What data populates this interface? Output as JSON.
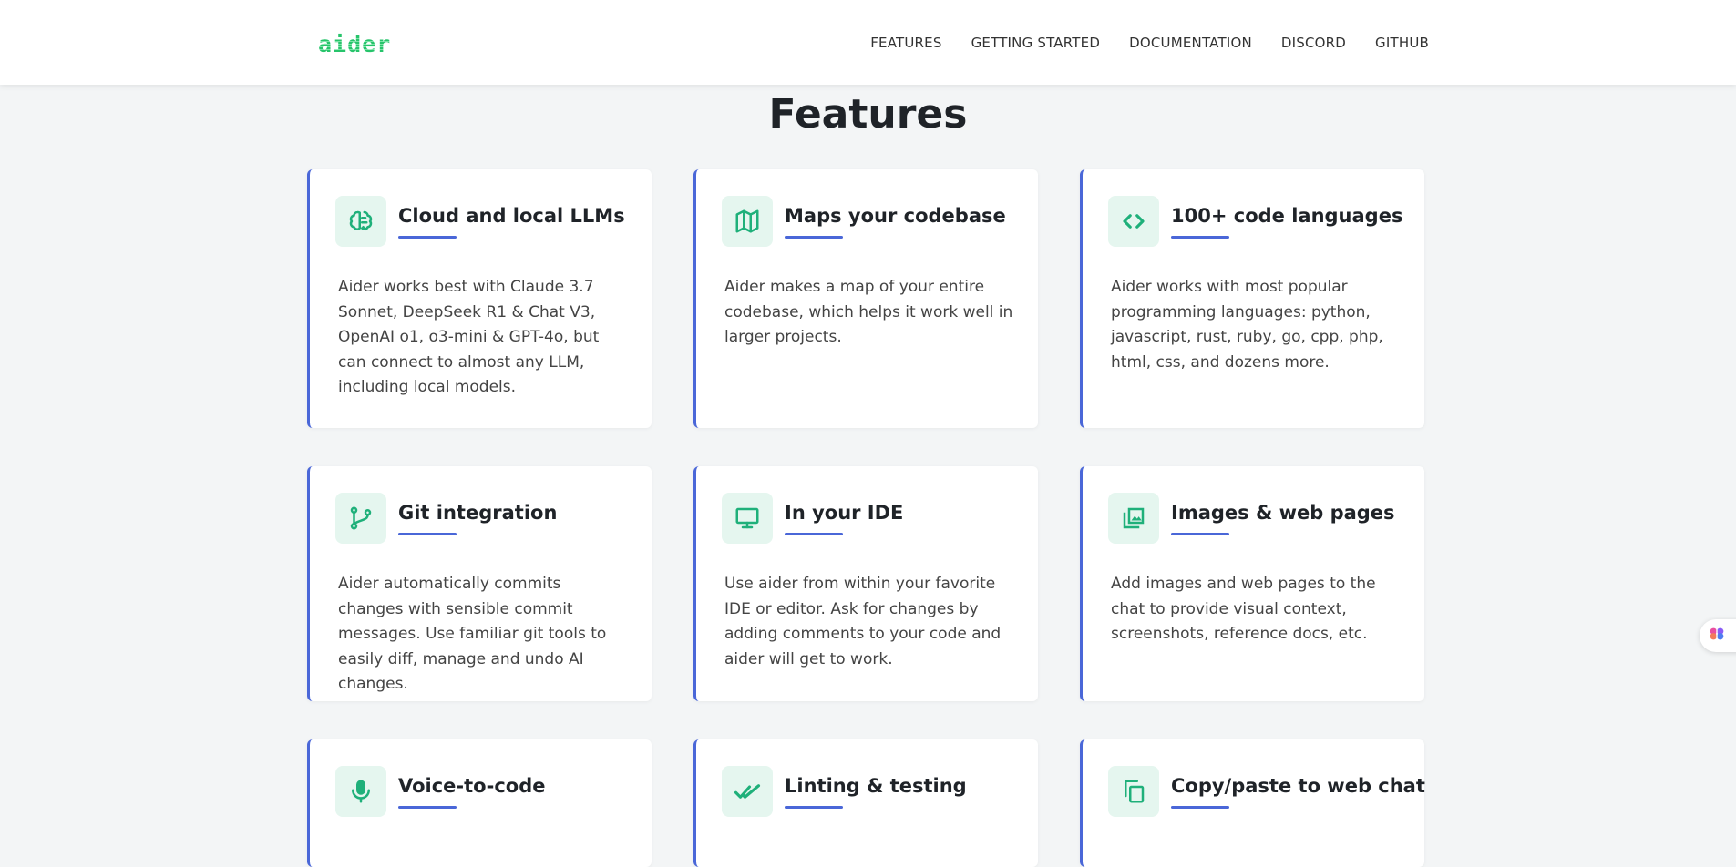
{
  "header": {
    "logo": "aider",
    "nav": [
      "FEATURES",
      "GETTING STARTED",
      "DOCUMENTATION",
      "DISCORD",
      "GITHUB"
    ]
  },
  "page_title": "Features",
  "colors": {
    "accent": "#4a67d8",
    "icon_green": "#1fb07a",
    "icon_bg": "#e5f6ef",
    "logo_green": "#27c46b"
  },
  "features": [
    {
      "icon": "brain-icon",
      "title": "Cloud and local LLMs",
      "text": "Aider works best with Claude 3.7 Sonnet, DeepSeek R1 & Chat V3, OpenAI o1, o3-mini & GPT-4o, but can connect to almost any LLM, including local models."
    },
    {
      "icon": "map-icon",
      "title": "Maps your codebase",
      "text": "Aider makes a map of your entire codebase, which helps it work well in larger projects."
    },
    {
      "icon": "code-icon",
      "title": "100+ code languages",
      "text": "Aider works with most popular programming languages: python, javascript, rust, ruby, go, cpp, php, html, css, and dozens more."
    },
    {
      "icon": "git-branch-icon",
      "title": "Git integration",
      "text": "Aider automatically commits changes with sensible commit messages. Use familiar git tools to easily diff, manage and undo AI changes."
    },
    {
      "icon": "monitor-icon",
      "title": "In your IDE",
      "text": "Use aider from within your favorite IDE or editor. Ask for changes by adding comments to your code and aider will get to work."
    },
    {
      "icon": "images-icon",
      "title": "Images & web pages",
      "text": "Add images and web pages to the chat to provide visual context, screenshots, reference docs, etc."
    },
    {
      "icon": "microphone-icon",
      "title": "Voice-to-code",
      "text": ""
    },
    {
      "icon": "double-check-icon",
      "title": "Linting & testing",
      "text": ""
    },
    {
      "icon": "copy-icon",
      "title": "Copy/paste to web chat",
      "text": ""
    }
  ],
  "floating_button": {
    "icon": "brain-badge-icon"
  }
}
